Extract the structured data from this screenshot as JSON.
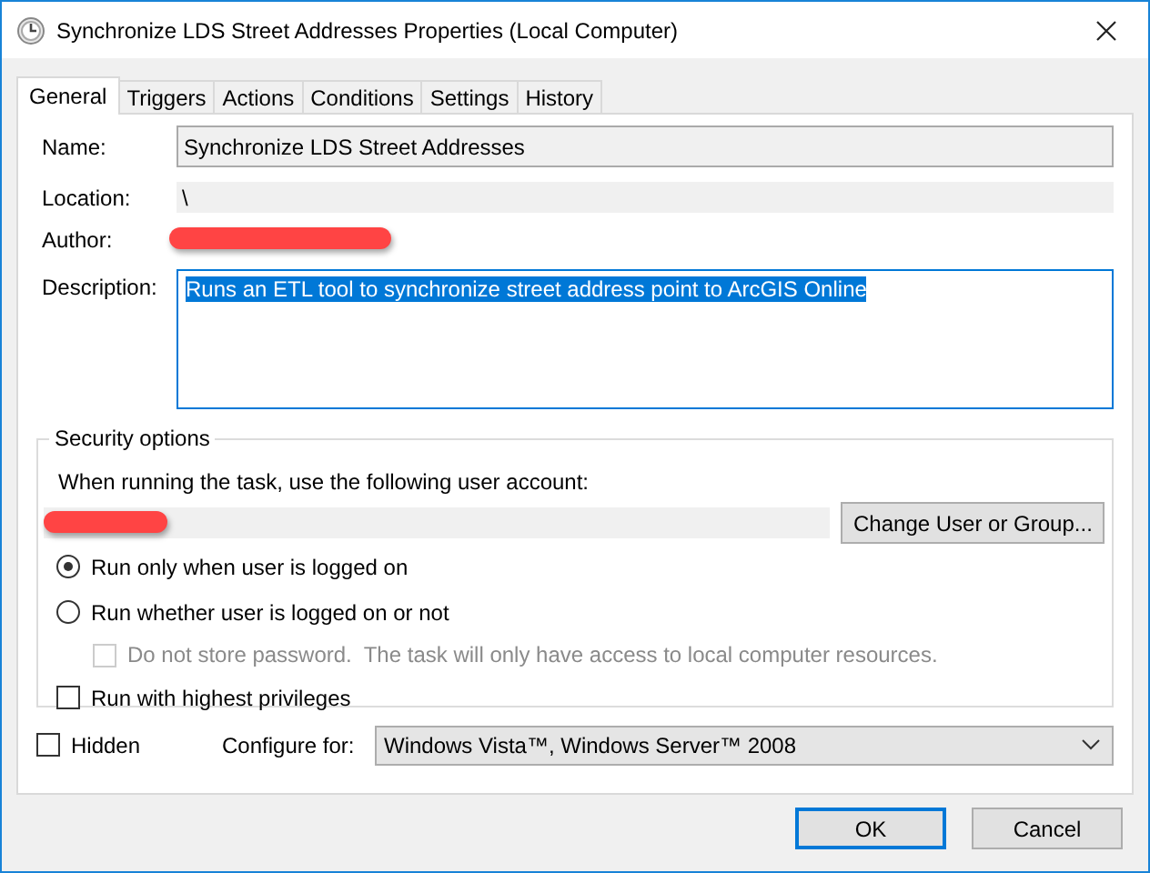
{
  "window": {
    "title": "Synchronize LDS Street Addresses Properties (Local Computer)"
  },
  "tabs": [
    {
      "label": "General",
      "selected": true
    },
    {
      "label": "Triggers",
      "selected": false
    },
    {
      "label": "Actions",
      "selected": false
    },
    {
      "label": "Conditions",
      "selected": false
    },
    {
      "label": "Settings",
      "selected": false
    },
    {
      "label": "History",
      "selected": false
    }
  ],
  "general": {
    "name": {
      "label": "Name:",
      "value": "Synchronize LDS Street Addresses"
    },
    "location": {
      "label": "Location:",
      "value": "\\"
    },
    "author": {
      "label": "Author:"
    },
    "description": {
      "label": "Description:",
      "value": "Runs an ETL tool to synchronize street address point to ArcGIS Online",
      "selected": true
    }
  },
  "security": {
    "title": "Security options",
    "account_label": "When running the task, use the following user account:",
    "change_button": "Change User or Group...",
    "options": [
      {
        "kind": "radio",
        "label": "Run only when user is logged on",
        "checked": true,
        "disabled": false
      },
      {
        "kind": "radio",
        "label": "Run whether user is logged on or not",
        "checked": false,
        "disabled": false,
        "children": [
          {
            "kind": "checkbox",
            "label": "Do not store password.  The task will only have access to local computer resources.",
            "checked": false,
            "disabled": true
          }
        ]
      },
      {
        "kind": "checkbox",
        "label": "Run with highest privileges",
        "checked": false,
        "disabled": false
      }
    ]
  },
  "hidden": {
    "label": "Hidden",
    "checked": false
  },
  "configure": {
    "label": "Configure for:",
    "value": "Windows Vista™, Windows Server™ 2008"
  },
  "buttons": [
    {
      "label": "OK",
      "default": true
    },
    {
      "label": "Cancel",
      "default": false
    }
  ]
}
